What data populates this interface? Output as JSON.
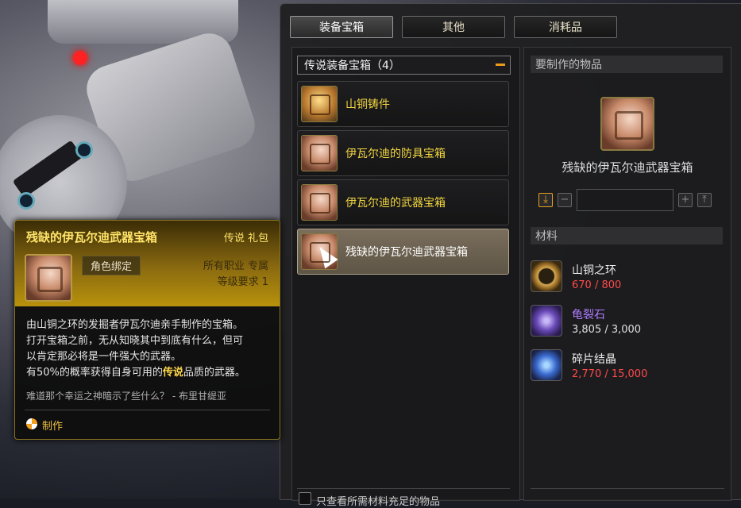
{
  "tabs": [
    "装备宝箱",
    "其他",
    "消耗品"
  ],
  "category": {
    "title": "传说装备宝箱（4）"
  },
  "items": [
    {
      "label": "山铜铸件"
    },
    {
      "label": "伊瓦尔迪的防具宝箱"
    },
    {
      "label": "伊瓦尔迪的武器宝箱"
    },
    {
      "label": "残缺的伊瓦尔迪武器宝箱"
    }
  ],
  "filter": {
    "label": "只查看所需材料充足的物品"
  },
  "craft": {
    "section_title": "要制作的物品",
    "item_name": "残缺的伊瓦尔迪武器宝箱",
    "materials_title": "材料",
    "materials": [
      {
        "name": "山铜之环",
        "count": "670 / 800",
        "count_color": "#ff4a4a",
        "icon": "ring-icon"
      },
      {
        "name": "龟裂石",
        "count": "3,805 / 3,000",
        "count_color": "#e0e0e0",
        "icon": "stone-icon"
      },
      {
        "name": "碎片结晶",
        "count": "2,770 / 15,000",
        "count_color": "#ff4a4a",
        "icon": "crystal-icon"
      }
    ]
  },
  "tooltip": {
    "title": "残缺的伊瓦尔迪武器宝箱",
    "grade": "传说 礼包",
    "bind": "角色绑定",
    "class": "所有职业 专属",
    "level": "等级要求 1",
    "desc_line1": "由山铜之环的发掘者伊瓦尔迪亲手制作的宝箱。",
    "desc_line2": "打开宝箱之前，无从知晓其中到底有什么，但可",
    "desc_line3": "以肯定那必将是一件强大的武器。",
    "desc_line4_pre": "有50%的概率获得自身可用的",
    "desc_line4_hl": "传说",
    "desc_line4_post": "品质的武器。",
    "flavor": "难道那个幸运之神暗示了些什么？ - 布里甘缇亚",
    "craft_label": "制作"
  }
}
